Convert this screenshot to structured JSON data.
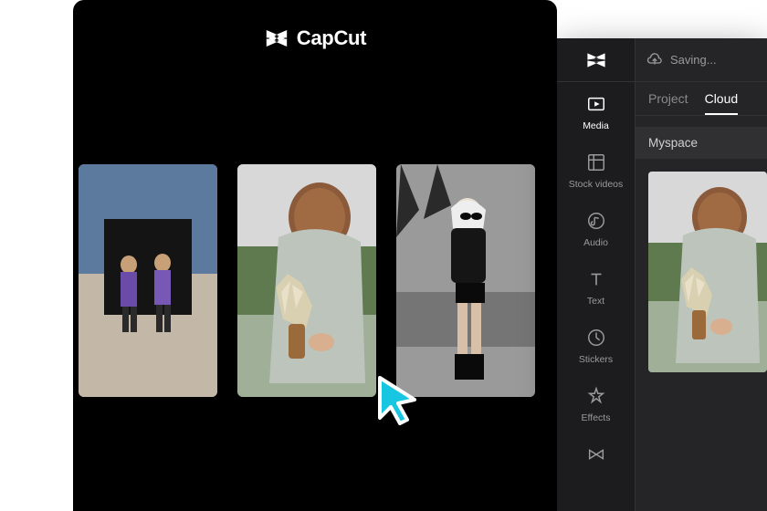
{
  "app": {
    "name": "CapCut"
  },
  "editor": {
    "status": "Saving...",
    "tabs": {
      "project": "Project",
      "cloud": "Cloud",
      "active": "cloud"
    },
    "space": "Myspace"
  },
  "sidebar": [
    {
      "key": "media",
      "label": "Media",
      "active": true
    },
    {
      "key": "stock",
      "label": "Stock videos"
    },
    {
      "key": "audio",
      "label": "Audio"
    },
    {
      "key": "text",
      "label": "Text"
    },
    {
      "key": "stickers",
      "label": "Stickers"
    },
    {
      "key": "effects",
      "label": "Effects"
    },
    {
      "key": "transition",
      "label": ""
    }
  ]
}
